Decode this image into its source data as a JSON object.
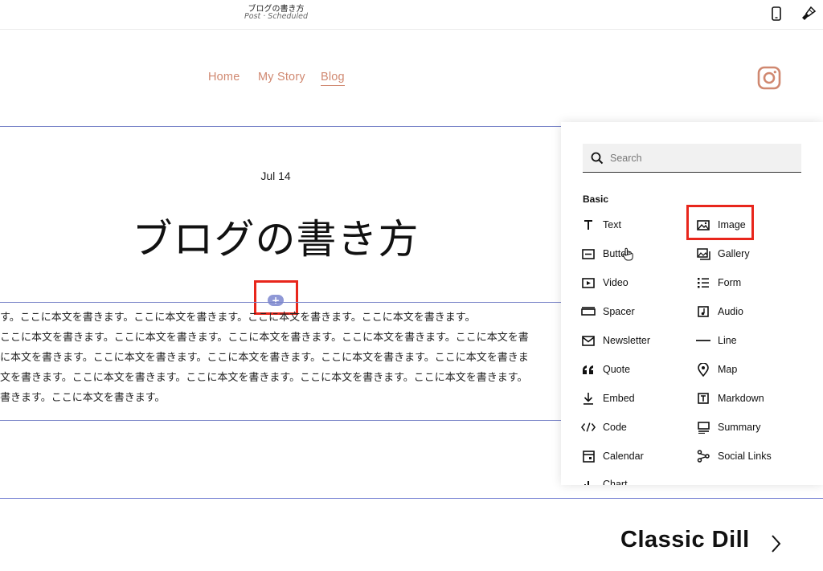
{
  "topbar": {
    "title": "ブログの書き方",
    "subtitle": "Post · Scheduled",
    "mobile_icon": "mobile-phone-icon",
    "design_icon": "paintbrush-icon"
  },
  "nav": {
    "links": [
      {
        "label": "Home"
      },
      {
        "label": "My Story"
      },
      {
        "label": "Blog",
        "active": true
      }
    ],
    "social_icon": "instagram-icon"
  },
  "post": {
    "date": "Jul 14",
    "title": "ブログの書き方",
    "add_button": "+",
    "body_lines": [
      "す。ここに本文を書きます。ここに本文を書きます。ここに本文を書きます。ここに本文を書きます。",
      "ここに本文を書きます。ここに本文を書きます。ここに本文を書きます。ここに本文を書きます。ここに本文を書",
      "に本文を書きます。ここに本文を書きます。ここに本文を書きます。ここに本文を書きます。ここに本文を書きま",
      "文を書きます。ここに本文を書きます。ここに本文を書きます。ここに本文を書きます。ここに本文を書きます。",
      "書きます。ここに本文を書きます。"
    ]
  },
  "footer": {
    "next_title": "Classic Dill"
  },
  "panel": {
    "search_placeholder": "Search",
    "section": "Basic",
    "left_items": [
      {
        "label": "Text",
        "icon": "text-icon"
      },
      {
        "label": "Button",
        "icon": "button-icon"
      },
      {
        "label": "Video",
        "icon": "video-icon"
      },
      {
        "label": "Spacer",
        "icon": "spacer-icon"
      },
      {
        "label": "Newsletter",
        "icon": "newsletter-icon"
      },
      {
        "label": "Quote",
        "icon": "quote-icon"
      },
      {
        "label": "Embed",
        "icon": "embed-icon"
      },
      {
        "label": "Code",
        "icon": "code-icon"
      },
      {
        "label": "Calendar",
        "icon": "calendar-icon"
      },
      {
        "label": "Chart",
        "icon": "chart-icon"
      }
    ],
    "right_items": [
      {
        "label": "Image",
        "icon": "image-icon"
      },
      {
        "label": "Gallery",
        "icon": "gallery-icon"
      },
      {
        "label": "Form",
        "icon": "form-icon"
      },
      {
        "label": "Audio",
        "icon": "audio-icon"
      },
      {
        "label": "Line",
        "icon": "line-icon"
      },
      {
        "label": "Map",
        "icon": "map-pin-icon"
      },
      {
        "label": "Markdown",
        "icon": "markdown-icon"
      },
      {
        "label": "Summary",
        "icon": "summary-icon"
      },
      {
        "label": "Social Links",
        "icon": "social-links-icon"
      }
    ]
  },
  "colors": {
    "nav_link": "#d08870",
    "section_outline": "#7b86c9",
    "highlight": "#e8261c",
    "add_button": "#8f98d6"
  }
}
